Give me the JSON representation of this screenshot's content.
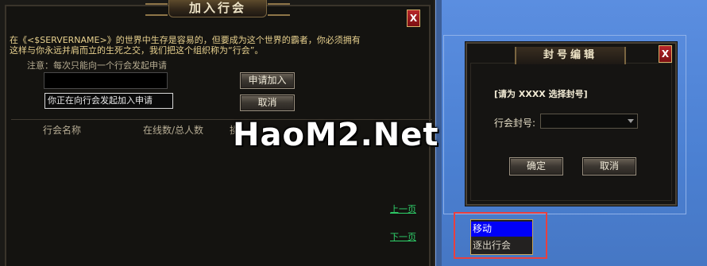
{
  "join_window": {
    "title": "加入行会",
    "close_label": "X",
    "description": "在《<$SERVERNAME>》的世界中生存是容易的，但要成为这个世界的霸者，你必须拥有这样与你永远并肩而立的生死之交，我们把这个组织称为“行会”。",
    "note": "注意：每次只能向一个行会发起申请",
    "guild_input_value": "",
    "status_text": "你正在向行会发起加入申请",
    "apply_button": "申请加入",
    "cancel_button": "取消",
    "columns": [
      "行会名称",
      "在线数/总人数",
      "操"
    ],
    "prev_page": "上一页",
    "next_page": "下一页"
  },
  "title_dialog": {
    "title": "封号编辑",
    "close_label": "X",
    "prompt": "[请为 XXXX 选择封号]",
    "field_label": "行会封号:",
    "select_value": "",
    "confirm_button": "确定",
    "cancel_button": "取消"
  },
  "watermark": "HaoM2.Net",
  "context_menu": {
    "items": [
      {
        "label": "移动",
        "active": true
      },
      {
        "label": "逐出行会",
        "active": false
      }
    ]
  },
  "colors": {
    "background": "#4a7fd0",
    "window_bg": "#1b1a17",
    "description_text": "#e9d28f",
    "link_green": "#2fd36b",
    "menu_highlight": "#0000f8",
    "close_red": "#b8262a",
    "callout_red": "#e84040"
  }
}
